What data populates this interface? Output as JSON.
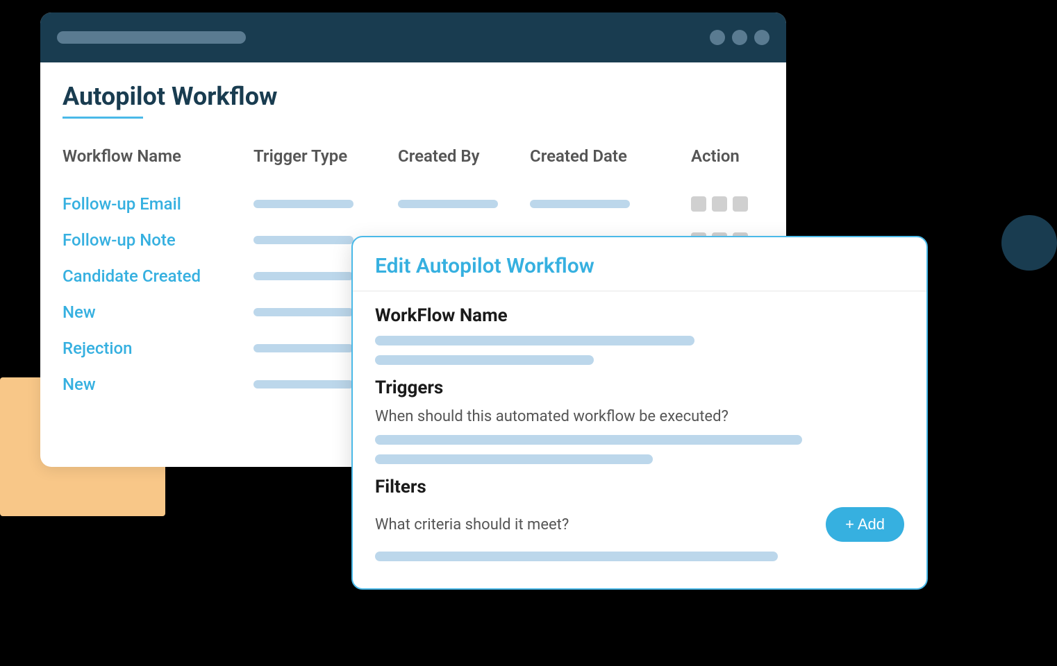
{
  "main": {
    "title": "Autopilot Workflow",
    "columns": {
      "name": "Workflow Name",
      "trigger": "Trigger Type",
      "createdBy": "Created By",
      "createdDate": "Created Date",
      "action": "Action"
    },
    "rows": [
      {
        "name": "Follow-up Email"
      },
      {
        "name": "Follow-up Note"
      },
      {
        "name": "Candidate Created"
      },
      {
        "name": "New"
      },
      {
        "name": "Rejection"
      },
      {
        "name": "New"
      }
    ]
  },
  "edit": {
    "title": "Edit Autopilot Workflow",
    "workflowNameLabel": "WorkFlow Name",
    "triggersLabel": "Triggers",
    "triggersSubtext": "When should this automated workflow be executed?",
    "filtersLabel": "Filters",
    "filtersSubtext": "What criteria should it meet?",
    "addButton": "+ Add"
  }
}
